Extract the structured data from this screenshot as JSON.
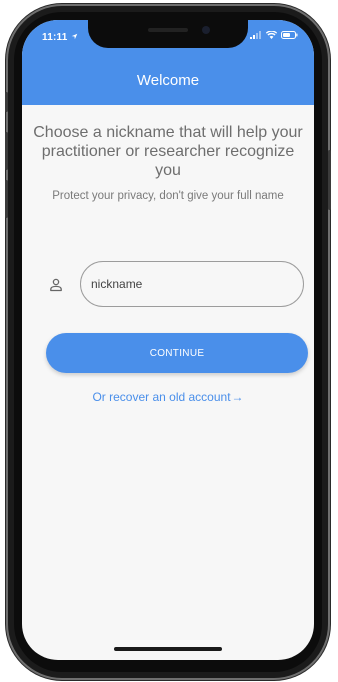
{
  "status_bar": {
    "time": "11:11",
    "location_icon": "location-arrow-icon",
    "icons": [
      "signal-icon",
      "wifi-icon",
      "battery-icon"
    ]
  },
  "app_bar": {
    "title": "Welcome",
    "color": "#4a8fea"
  },
  "main": {
    "headline": "Choose a nickname that will help your practitioner or researcher recognize you",
    "subline": "Protect your privacy, don't give your full name",
    "nickname_field": {
      "icon": "person-icon",
      "placeholder": "nickname",
      "value": ""
    },
    "continue_label": "CONTINUE",
    "recover_label": "Or recover an old account",
    "recover_arrow": "→"
  },
  "colors": {
    "accent": "#4a8fea",
    "background": "#f7f7f7",
    "text_muted": "#6e6e6e"
  }
}
